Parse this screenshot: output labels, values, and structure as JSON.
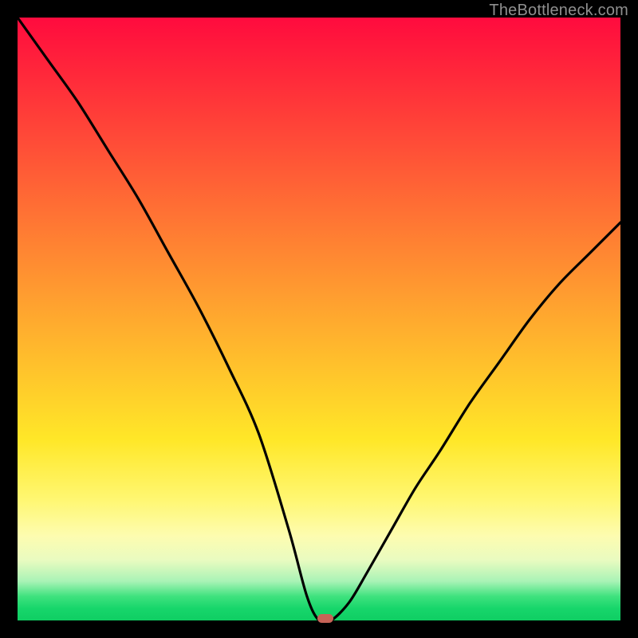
{
  "watermark": "TheBottleneck.com",
  "chart_data": {
    "type": "line",
    "title": "",
    "xlabel": "",
    "ylabel": "",
    "xlim": [
      0,
      100
    ],
    "ylim": [
      0,
      100
    ],
    "grid": false,
    "legend": false,
    "series": [
      {
        "name": "bottleneck-curve",
        "x": [
          0,
          5,
          10,
          15,
          20,
          25,
          30,
          35,
          40,
          45,
          48,
          50,
          52,
          55,
          58,
          62,
          66,
          70,
          75,
          80,
          85,
          90,
          95,
          100
        ],
        "y": [
          100,
          93,
          86,
          78,
          70,
          61,
          52,
          42,
          31,
          15,
          4,
          0,
          0,
          3,
          8,
          15,
          22,
          28,
          36,
          43,
          50,
          56,
          61,
          66
        ]
      }
    ],
    "optimal_marker": {
      "x": 51,
      "y": 0.3
    },
    "gradient_stops": [
      {
        "pos": 0,
        "color": "#ff0b3e"
      },
      {
        "pos": 0.48,
        "color": "#ffa32f"
      },
      {
        "pos": 0.8,
        "color": "#fff772"
      },
      {
        "pos": 0.96,
        "color": "#3fe27e"
      },
      {
        "pos": 1.0,
        "color": "#0fce63"
      }
    ]
  }
}
